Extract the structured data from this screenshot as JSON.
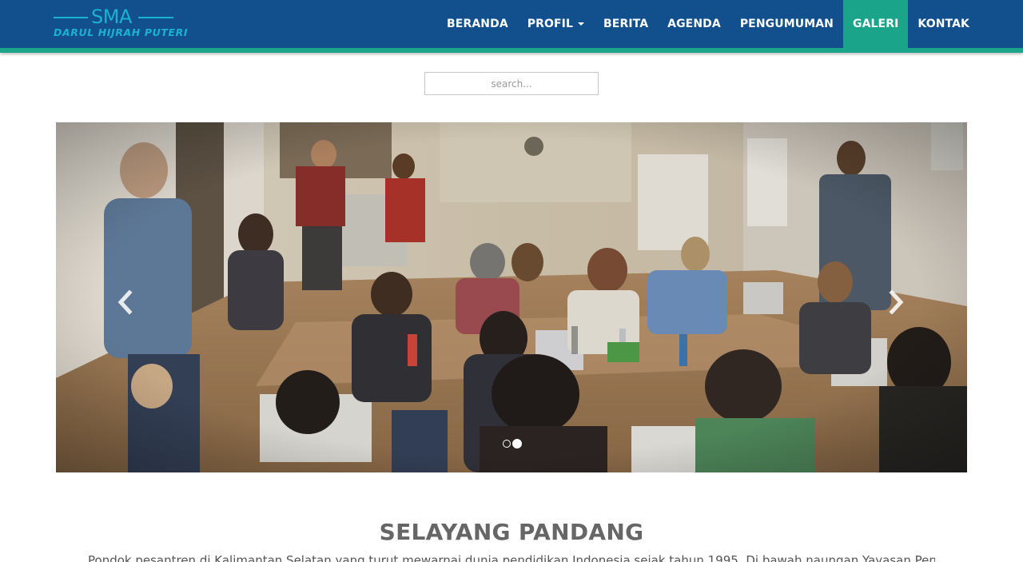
{
  "brand": {
    "title": "SMA",
    "subtitle": "DARUL HIJRAH PUTERI"
  },
  "nav": {
    "items": [
      {
        "label": "BERANDA"
      },
      {
        "label": "PROFIL"
      },
      {
        "label": "BERITA"
      },
      {
        "label": "AGENDA"
      },
      {
        "label": "PENGUMUMAN"
      },
      {
        "label": "GALERI"
      },
      {
        "label": "KONTAK"
      }
    ],
    "active": "GALERI"
  },
  "search": {
    "placeholder": "search..."
  },
  "carousel": {
    "image": "classroom-photo",
    "slide_count": 2,
    "active_slide": 2,
    "prev_icon": "chevron-left-icon",
    "next_icon": "chevron-right-icon"
  },
  "section": {
    "title": "SELAYANG PANDANG",
    "text": "Pondok pesantren di Kalimantan Selatan yang turut mewarnai dunia pendidikan Indonesia sejak tahun 1995. Di bawah naungan Yayasan Pendidikan Darul"
  },
  "colors": {
    "navbar": "#124f8d",
    "accent": "#1aa58a",
    "brand": "#19b3cf",
    "heading": "#666666"
  }
}
